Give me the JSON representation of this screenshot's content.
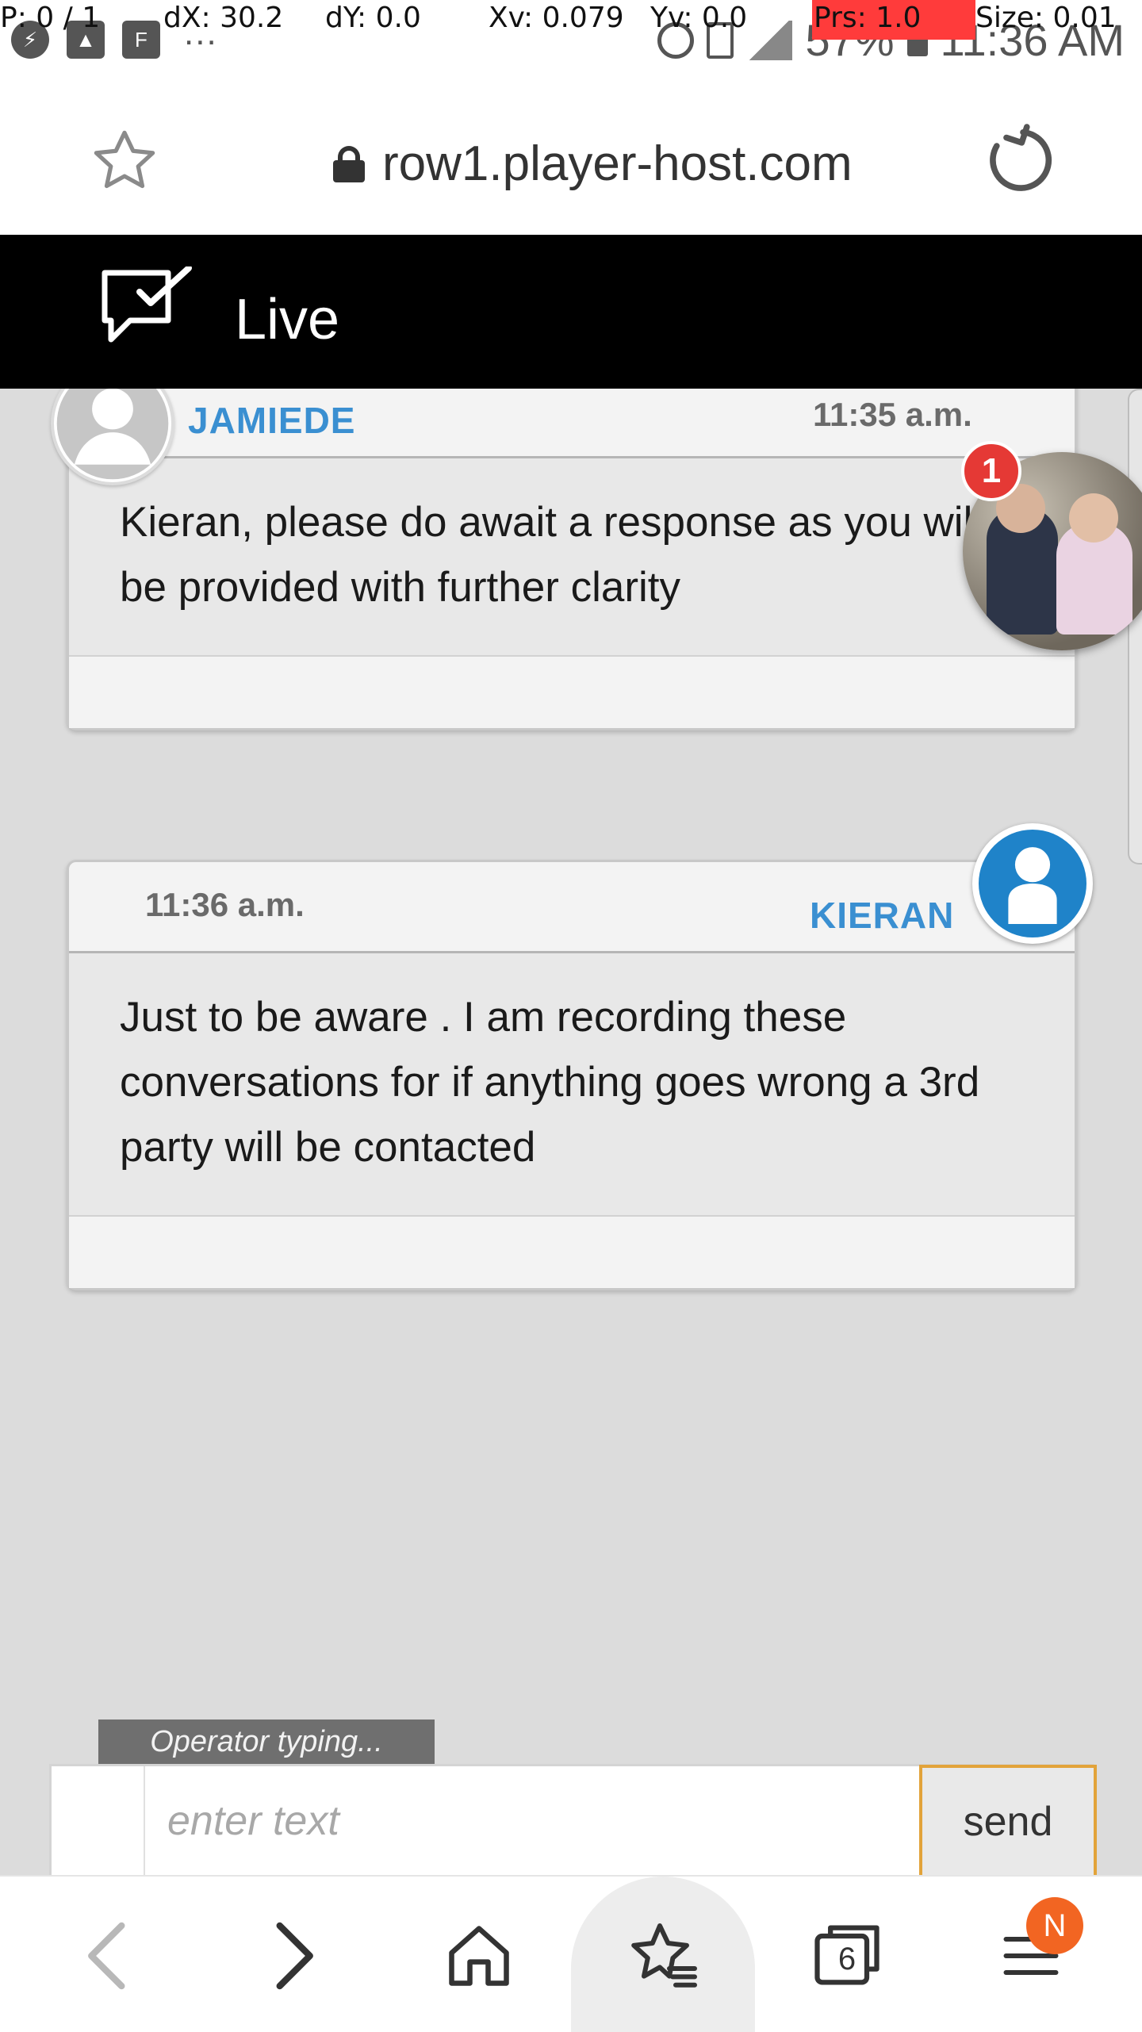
{
  "status_bar": {
    "debug": {
      "p": "P: 0 / 1",
      "dx": "dX: 30.2",
      "dy": "dY: 0.0",
      "xv": "Xv: 0.079",
      "yv": "Yv: 0.0",
      "prs": "Prs: 1.0",
      "size": "Size: 0.01"
    },
    "battery": "57%",
    "clock": "11:36 AM",
    "overflow": "..."
  },
  "browser": {
    "url": "row1.player-host.com"
  },
  "header": {
    "title": "Live"
  },
  "messages": [
    {
      "sender": "JAMIEDE",
      "time": "11:35 a.m.",
      "text": "Kieran, please do await a response as you will be provided with further clarity"
    },
    {
      "sender": "KIERAN",
      "time": "11:36 a.m.",
      "text": "Just to be aware . I am recording these conversations for if anything goes wrong a 3rd party will be contacted"
    }
  ],
  "chat_bubble": {
    "badge_count": "1"
  },
  "composer": {
    "typing_indicator": "Operator typing...",
    "placeholder": "enter text",
    "send_label": "send"
  },
  "bottom_nav": {
    "tabs_count": "6",
    "menu_badge": "N"
  },
  "colors": {
    "header_bg": "#000000",
    "name_blue": "#3a8fd1",
    "send_border": "#e2a33a",
    "badge_red": "#e53935",
    "menu_badge_orange": "#f26522"
  }
}
